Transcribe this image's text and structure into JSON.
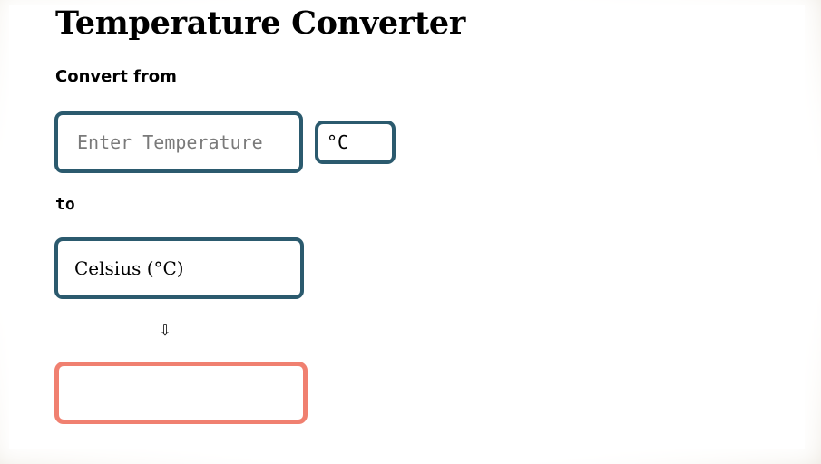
{
  "title": "Temperature Converter",
  "from_label": "Convert from",
  "input": {
    "placeholder": "Enter Temperature",
    "value": ""
  },
  "input_unit": "°C",
  "to_label": "to",
  "target_unit": {
    "selected": "Celsius (°C)"
  },
  "arrow_glyph": "⇩",
  "result": {
    "value": ""
  },
  "colors": {
    "border_accent": "#2b5a6e",
    "result_border": "#f08070",
    "background": "#ebe6dc"
  },
  "icons": {
    "arrow": "arrow-down-icon"
  }
}
